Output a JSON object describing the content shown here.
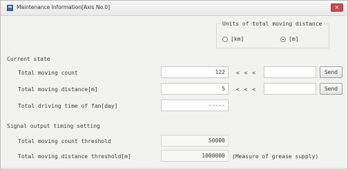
{
  "window": {
    "title": "Maintenance Information[Axis No.0]",
    "close_label": "×"
  },
  "units": {
    "legend": "Units of total moving distance",
    "option_km": "[km]",
    "option_m": "[m]",
    "selected": "[m]"
  },
  "current_state": {
    "heading": "Current state",
    "moving_count_label": "Total moving count",
    "moving_count_value": "122",
    "moving_distance_label": "Total moving distance[m]",
    "moving_distance_value": "5",
    "fan_time_label": "Total driving time of fan[day]",
    "fan_time_value": "-----",
    "arrows": "< < <",
    "send_label": "Send"
  },
  "signal": {
    "heading": "Signal output timing setting",
    "count_threshold_label": "Total moving count threshold",
    "count_threshold_value": "50000",
    "distance_threshold_label": "Total moving distance threshold[m]",
    "distance_threshold_value": "1000000",
    "distance_threshold_note": "(Measure of grease supply)"
  }
}
